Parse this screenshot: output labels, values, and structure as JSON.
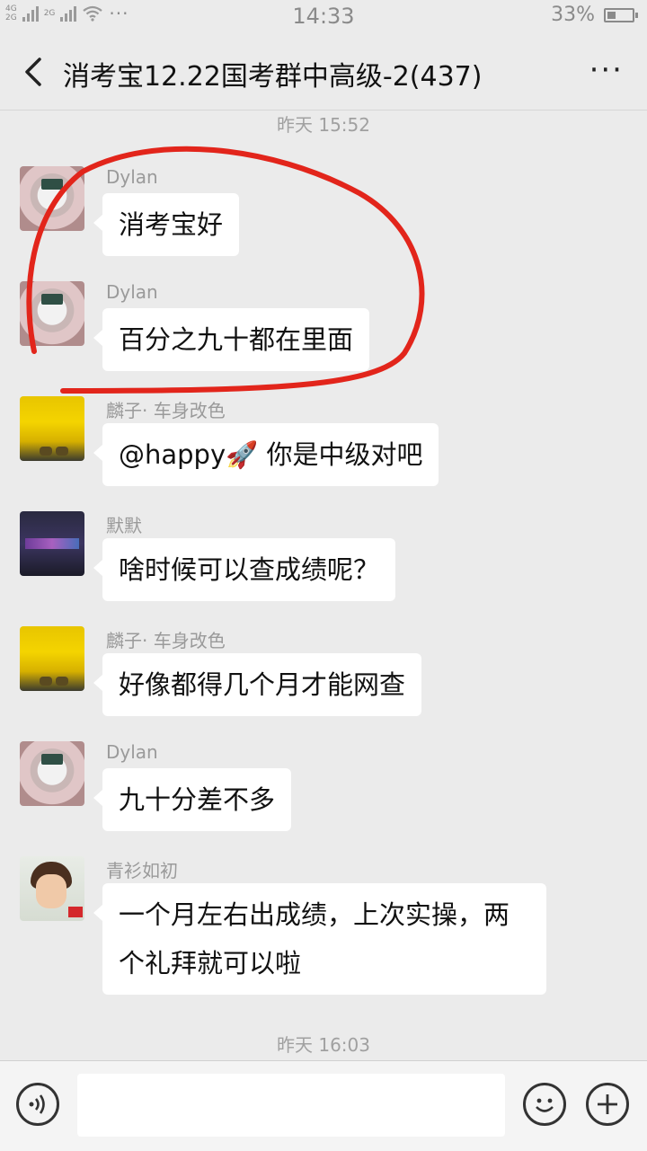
{
  "status_bar": {
    "network_top": "4G",
    "network_bottom": "2G",
    "network2": "2G",
    "time": "14:33",
    "battery": "33%",
    "battery_level": 0.33,
    "dots": "···"
  },
  "header": {
    "title": "消考宝12.22国考群中高级-2(437)",
    "more": "···"
  },
  "timestamps": [
    "昨天 15:52",
    "昨天 16:03"
  ],
  "messages": [
    {
      "sender": "Dylan",
      "text": "消考宝好"
    },
    {
      "sender": "Dylan",
      "text": "百分之九十都在里面"
    },
    {
      "sender": "麟子· 车身改色",
      "text": "@happy🚀 你是中级对吧"
    },
    {
      "sender": "默默",
      "text": "啥时候可以查成绩呢？"
    },
    {
      "sender": "麟子· 车身改色",
      "text": "好像都得几个月才能网查"
    },
    {
      "sender": "Dylan",
      "text": "九十分差不多"
    },
    {
      "sender": "青衫如初",
      "text": "一个月左右出成绩，上次实操，两个礼拜就可以啦"
    }
  ],
  "input": {
    "placeholder": ""
  },
  "icons": {
    "voice": "voice-icon",
    "emoji": "emoji-icon",
    "plus": "plus-icon",
    "back": "back-arrow-icon"
  },
  "colors": {
    "background": "#ebebeb",
    "bubble": "#ffffff",
    "annotation": "#e2251b"
  }
}
